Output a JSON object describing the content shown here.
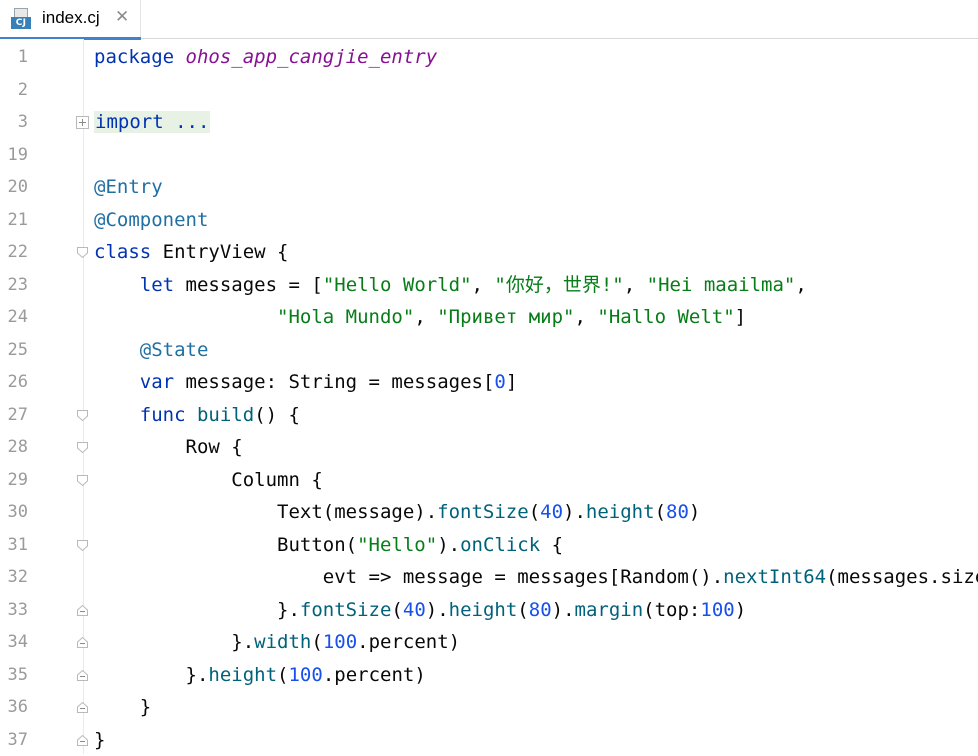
{
  "tab": {
    "icon_label": "CJ",
    "filename": "index.cj",
    "close_glyph": "✕"
  },
  "icons": {
    "file": "cangjie-file-icon",
    "close": "close-icon",
    "fold_expand": "fold-expand-icon",
    "fold_open": "fold-open-icon",
    "fold_close": "fold-close-icon"
  },
  "line_numbers": [
    "1",
    "2",
    "3",
    "19",
    "20",
    "21",
    "22",
    "23",
    "24",
    "25",
    "26",
    "27",
    "28",
    "29",
    "30",
    "31",
    "32",
    "33",
    "34",
    "35",
    "36",
    "37"
  ],
  "code": {
    "l1": [
      "package",
      "ohos_app_cangjie_entry"
    ],
    "l3": [
      "import ..."
    ],
    "l20": [
      "@Entry"
    ],
    "l21": [
      "@Component"
    ],
    "l22": [
      "class",
      " EntryView {"
    ],
    "l23": [
      "    ",
      "let",
      " messages = [",
      "\"Hello World\"",
      ", ",
      "\"你好，世界!\"",
      ", ",
      "\"Hei maailma\"",
      ","
    ],
    "l24": [
      "                ",
      "\"Hola Mundo\"",
      ", ",
      "\"Привет мир\"",
      ", ",
      "\"Hallo Welt\"",
      "]"
    ],
    "l25": [
      "    ",
      "@State"
    ],
    "l26": [
      "    ",
      "var",
      " message: String = messages[",
      "0",
      "]"
    ],
    "l27": [
      "    ",
      "func",
      " ",
      "build",
      "() {"
    ],
    "l28": [
      "        Row {"
    ],
    "l29": [
      "            Column {"
    ],
    "l30": [
      "                Text(message).",
      "fontSize",
      "(",
      "40",
      ").",
      "height",
      "(",
      "80",
      ")"
    ],
    "l31": [
      "                Button(",
      "\"Hello\"",
      ").",
      "onClick",
      " {"
    ],
    "l32": [
      "                    evt => message = messages[Random().",
      "nextInt64",
      "(messages.size)]"
    ],
    "l33": [
      "                }.",
      "fontSize",
      "(",
      "40",
      ").",
      "height",
      "(",
      "80",
      ").",
      "margin",
      "(top:",
      "100",
      ")"
    ],
    "l34": [
      "            }.",
      "width",
      "(",
      "100",
      ".percent)"
    ],
    "l35": [
      "        }.",
      "height",
      "(",
      "100",
      ".percent)"
    ],
    "l36": [
      "    }"
    ],
    "l37": [
      "}"
    ]
  },
  "colors": {
    "keyword": "#0033b3",
    "string": "#067d17",
    "number": "#1750eb",
    "annotation": "#1f6fa3",
    "function": "#00627a",
    "package": "#871094"
  }
}
